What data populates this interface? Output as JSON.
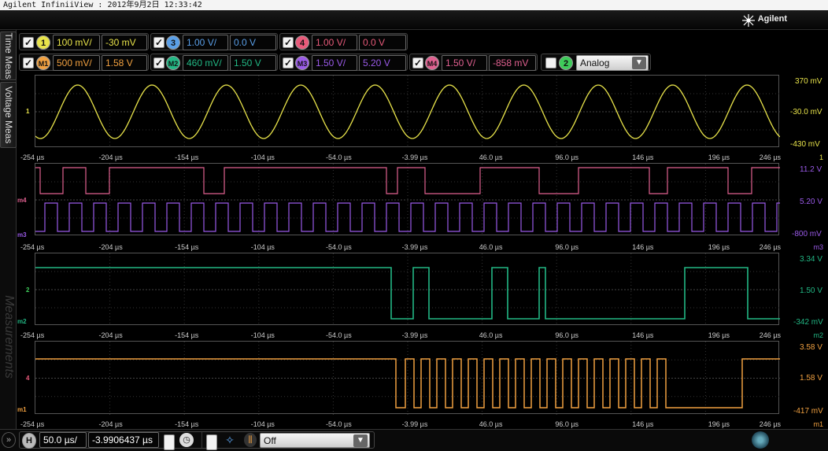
{
  "window": {
    "title": "Agilent InfiniiView : 2012年9月2日 12:33:42"
  },
  "brand": {
    "name": "Agilent"
  },
  "side_tabs": {
    "time_meas": "Time Meas",
    "voltage_meas": "Voltage Meas",
    "measurements": "Measurements"
  },
  "colors": {
    "ch1": "#e8e34a",
    "ch2": "#3ecb5a",
    "ch3": "#5a9fe8",
    "ch4": "#e85a7a",
    "m1": "#f0a040",
    "m2": "#22b784",
    "m3": "#9a5ae8",
    "m4": "#e06090",
    "grid": "#3a3a3a",
    "accent": "#ffffff"
  },
  "channels": [
    {
      "id": "1",
      "checked": "✓",
      "scale": "100 mV/",
      "offset": "-30 mV"
    },
    {
      "id": "3",
      "checked": "✓",
      "scale": "1.00 V/",
      "offset": "0.0 V"
    },
    {
      "id": "4",
      "checked": "✓",
      "scale": "1.00 V/",
      "offset": "0.0 V"
    }
  ],
  "math": [
    {
      "id": "M1",
      "checked": "✓",
      "scale": "500 mV/",
      "offset": "1.58 V"
    },
    {
      "id": "M2",
      "checked": "✓",
      "scale": "460 mV/",
      "offset": "1.50 V"
    },
    {
      "id": "M3",
      "checked": "✓",
      "scale": "1.50 V/",
      "offset": "5.20 V"
    },
    {
      "id": "M4",
      "checked": "✓",
      "scale": "1.50 V/",
      "offset": "-858 mV"
    }
  ],
  "analog": {
    "channel": "2",
    "checked": "",
    "mode": "Analog"
  },
  "time_ticks": [
    "-254 µs",
    "-204 µs",
    "-154 µs",
    "-104 µs",
    "-54.0 µs",
    "-3.99 µs",
    "46.0 µs",
    "96.0 µs",
    "146 µs",
    "196 µs",
    "246 µs"
  ],
  "panels": [
    {
      "id": "p1",
      "top_scale": "370 mV",
      "mid_scale": "-30.0 mV",
      "bottom_scale": "-430 mV",
      "tick_tag": "1"
    },
    {
      "id": "p2",
      "top_scale": "11.2 V",
      "mid_scale": "5.20 V",
      "bottom_scale": "-800 mV",
      "tick_tag": "m3"
    },
    {
      "id": "p3",
      "top_scale": "3.34 V",
      "mid_scale": "1.50 V",
      "bottom_scale": "-342 mV",
      "tick_tag": "m2"
    },
    {
      "id": "p4",
      "top_scale": "3.58 V",
      "mid_scale": "1.58 V",
      "bottom_scale": "-417 mV",
      "tick_tag": "m1"
    }
  ],
  "markers": {
    "p1": "1",
    "p2a": "m4",
    "p2b": "m3",
    "p3a": "2",
    "p3b": "m2",
    "p4a": "4",
    "p4b": "m1"
  },
  "horizontal": {
    "label": "H",
    "scale": "50.0 µs/",
    "position": "-3.9906437 µs",
    "checked": ""
  },
  "trigger": {
    "mode": "Off",
    "checked": ""
  }
}
